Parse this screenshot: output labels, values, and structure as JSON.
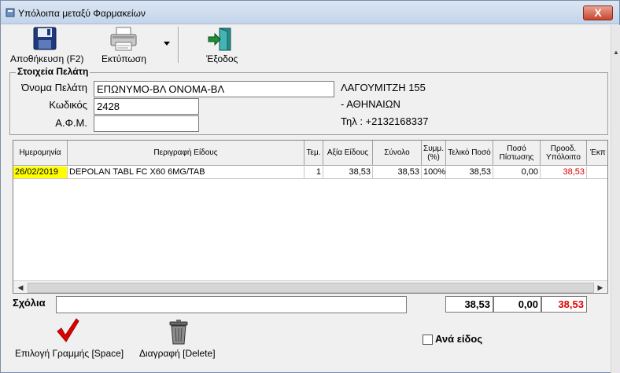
{
  "window": {
    "title": "Υπόλοιπα μεταξύ Φαρμακείων",
    "close": "X"
  },
  "toolbar": {
    "save_label": "Αποθήκευση (F2)",
    "print_label": "Εκτύπωση",
    "exit_label": "Έξοδος"
  },
  "customer": {
    "group_title": "Στοιχεία Πελάτη",
    "name_label": "Όνομα Πελάτη",
    "name_value": "ΕΠΩΝΥΜΟ-ΒΛ ΟΝΟΜΑ-ΒΛ",
    "code_label": "Κωδικός",
    "code_value": "2428",
    "afm_label": "Α.Φ.Μ.",
    "afm_value": "",
    "address": "ΛΑΓΟΥΜΙΤΖΗ 155",
    "city": " - ΑΘΗΝΑΙΩΝ",
    "phone": "Τηλ :  +2132168337"
  },
  "table": {
    "headers": [
      "Ημερομηνία",
      "Περιγραφή Είδους",
      "Τεμ.",
      "Αξία Είδους",
      "Σύνολο",
      "Συμμ. (%)",
      "Τελικό Ποσό",
      "Ποσό Πίστωσης",
      "Προοδ. Υπόλοιπο",
      "Έκπ"
    ],
    "rows": [
      {
        "date": "26/02/2019",
        "description": "DEPOLAN TABL FC X60 6MG/TAB",
        "qty": "1",
        "item_value": "38,53",
        "total": "38,53",
        "share": "100%",
        "final_amount": "38,53",
        "credit": "0,00",
        "running_balance": "38,53",
        "discount": ""
      }
    ]
  },
  "notes": {
    "label": "Σχόλια",
    "value": ""
  },
  "totals": {
    "final": "38,53",
    "credit": "0,00",
    "balance": "38,53"
  },
  "actions": {
    "select_label": "Επιλογή Γραμμής [Space]",
    "delete_label": "Διαγραφή [Delete]",
    "per_item_label": "Ανά είδος"
  },
  "colors": {
    "date_highlight": "#ffff00",
    "balance_red": "#e00000",
    "title_bar": "#c9d8ec"
  }
}
